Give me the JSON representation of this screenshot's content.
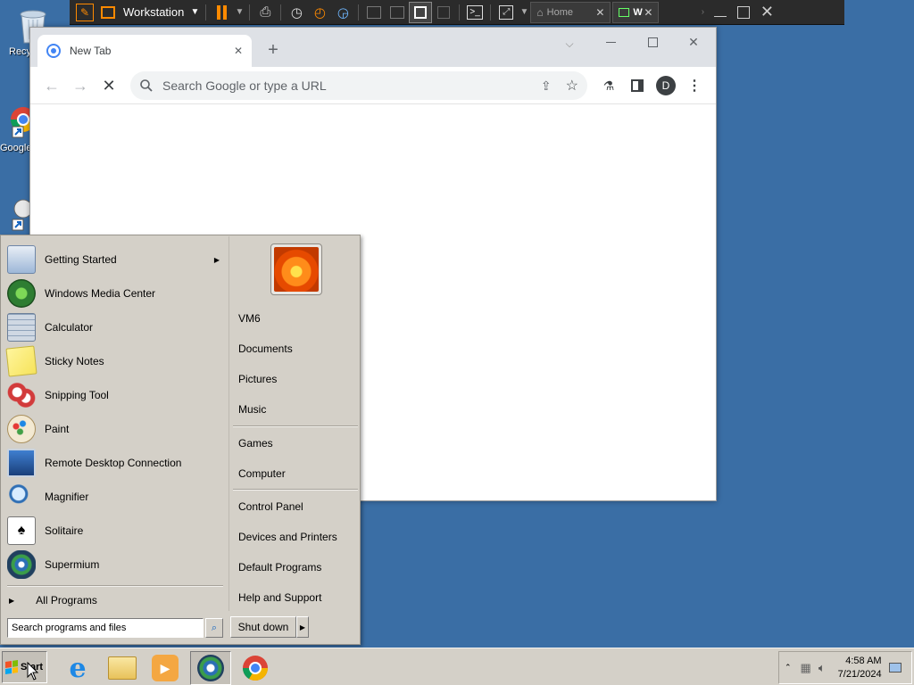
{
  "desktop": {
    "icons": [
      {
        "label": "Recy",
        "icon": "recycle-bin-icon"
      },
      {
        "label": "Google",
        "icon": "chrome-shortcut-icon"
      },
      {
        "label": "",
        "icon": "shortcut-icon"
      }
    ]
  },
  "vm_toolbar": {
    "vm_name": "Workstation",
    "tabs": [
      {
        "label": "Home",
        "icon": "home-icon"
      },
      {
        "label": "W",
        "icon": "vm-icon"
      }
    ],
    "accent": "#ff8a00"
  },
  "chrome": {
    "tab_title": "New Tab",
    "omnibox_placeholder": "Search Google or type a URL",
    "profile_initial": "D",
    "colors": {
      "tabstrip": "#dee1e6",
      "omnibox": "#f1f3f4",
      "avatar": "#3c4043"
    }
  },
  "start_menu": {
    "programs": [
      {
        "label": "Getting Started",
        "icon": "getting-started-icon",
        "has_submenu": true
      },
      {
        "label": "Windows Media Center",
        "icon": "media-center-icon"
      },
      {
        "label": "Calculator",
        "icon": "calculator-icon"
      },
      {
        "label": "Sticky Notes",
        "icon": "sticky-notes-icon"
      },
      {
        "label": "Snipping Tool",
        "icon": "snipping-tool-icon"
      },
      {
        "label": "Paint",
        "icon": "paint-icon"
      },
      {
        "label": "Remote Desktop Connection",
        "icon": "remote-desktop-icon"
      },
      {
        "label": "Magnifier",
        "icon": "magnifier-icon"
      },
      {
        "label": "Solitaire",
        "icon": "solitaire-icon"
      },
      {
        "label": "Supermium",
        "icon": "supermium-icon"
      }
    ],
    "all_programs": "All Programs",
    "search_placeholder": "Search programs and files",
    "shutdown_label": "Shut down",
    "right_groups": [
      [
        "VM6",
        "Documents",
        "Pictures",
        "Music"
      ],
      [
        "Games",
        "Computer"
      ],
      [
        "Control Panel",
        "Devices and Printers",
        "Default Programs",
        "Help and Support"
      ]
    ]
  },
  "taskbar": {
    "start_label": "Start",
    "pinned": [
      {
        "name": "internet-explorer-icon"
      },
      {
        "name": "file-explorer-icon"
      },
      {
        "name": "media-player-icon"
      },
      {
        "name": "supermium-icon"
      },
      {
        "name": "chrome-icon"
      }
    ],
    "time": "4:58 AM",
    "date": "7/21/2024"
  }
}
